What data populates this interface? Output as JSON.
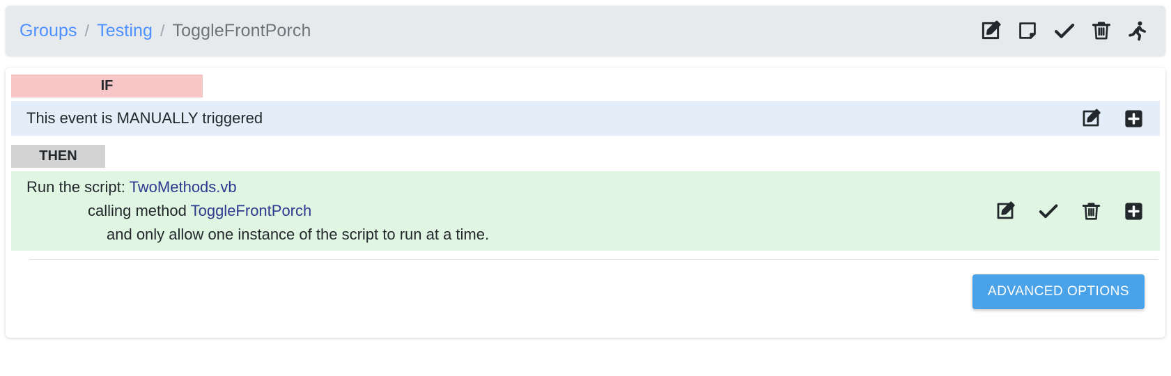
{
  "header": {
    "breadcrumb": {
      "group_label": "Groups",
      "separator": "/",
      "event_label": "Testing",
      "current_label": "ToggleFrontPorch"
    },
    "actions": [
      {
        "name": "edit-icon",
        "title": "Edit"
      },
      {
        "name": "note-icon",
        "title": "Note"
      },
      {
        "name": "check-icon",
        "title": "Enable"
      },
      {
        "name": "trash-icon",
        "title": "Delete"
      },
      {
        "name": "run-icon",
        "title": "Run"
      }
    ]
  },
  "rule": {
    "if_label": "IF",
    "then_label": "THEN",
    "condition": {
      "text": "This event is MANUALLY triggered",
      "actions": [
        {
          "name": "edit-icon",
          "title": "Edit"
        },
        {
          "name": "add-icon",
          "title": "Add"
        }
      ]
    },
    "action": {
      "line1_prefix": "Run the script:",
      "line1_link": "TwoMethods.vb",
      "line2_prefix": "calling method",
      "line2_link": "ToggleFrontPorch",
      "line3": "and only allow one instance of the script to run at a time.",
      "actions": [
        {
          "name": "edit-icon",
          "title": "Edit"
        },
        {
          "name": "check-icon",
          "title": "Confirm"
        },
        {
          "name": "trash-icon",
          "title": "Delete"
        },
        {
          "name": "add-icon",
          "title": "Add"
        }
      ]
    },
    "advanced_options_label": "ADVANCED OPTIONS"
  },
  "colors": {
    "if_bar": "#f7c6c7",
    "then_bar": "#d3d3d3",
    "condition_bg": "#e3eef8",
    "action_bg": "#e1f5e3",
    "header_bg": "#e6eaed",
    "link": "#4d90fe",
    "code_link": "#2b3a8f",
    "button": "#4aa3e8"
  }
}
